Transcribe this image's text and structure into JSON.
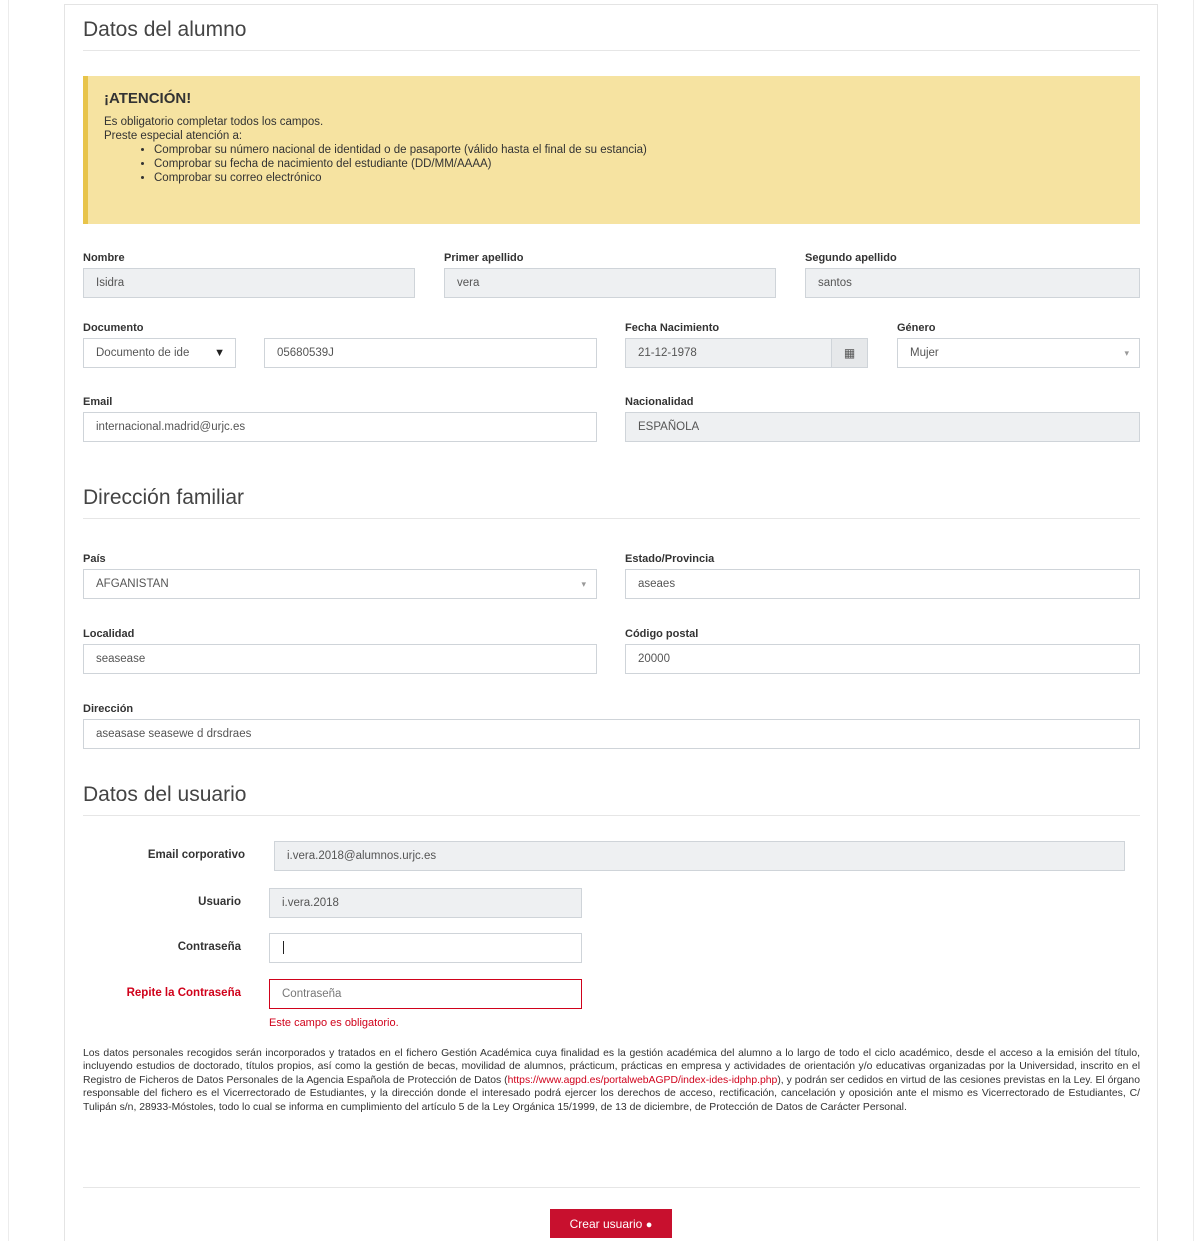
{
  "sections": {
    "alumno": "Datos del alumno",
    "direccion": "Dirección familiar",
    "usuario": "Datos del usuario"
  },
  "alert": {
    "title": "¡ATENCIÓN!",
    "line1": "Es obligatorio completar todos los campos.",
    "line2": "Preste especial atención a:",
    "items": [
      "Comprobar su número nacional de identidad o de pasaporte (válido hasta el final de su estancia)",
      "Comprobar su fecha de nacimiento del estudiante (DD/MM/AAAA)",
      "Comprobar su correo electrónico"
    ],
    "colors": {
      "background": "#f6e3a1",
      "border": "#e8c44a"
    }
  },
  "alumno": {
    "nombre": {
      "label": "Nombre",
      "value": "Isidra"
    },
    "apellido1": {
      "label": "Primer apellido",
      "value": "vera"
    },
    "apellido2": {
      "label": "Segundo apellido",
      "value": "santos"
    },
    "documento": {
      "label": "Documento",
      "type_value": "Documento de ide",
      "number_value": "05680539J"
    },
    "fecha": {
      "label": "Fecha Nacimiento",
      "value": "21-12-1978",
      "icon": "calendar-icon"
    },
    "genero": {
      "label": "Género",
      "value": "Mujer"
    },
    "email": {
      "label": "Email",
      "value": "internacional.madrid@urjc.es"
    },
    "nacionalidad": {
      "label": "Nacionalidad",
      "value": "ESPAÑOLA"
    }
  },
  "direccion": {
    "pais": {
      "label": "País",
      "value": "AFGANISTAN"
    },
    "estado": {
      "label": "Estado/Provincia",
      "value": "aseaes"
    },
    "localidad": {
      "label": "Localidad",
      "value": "seasease"
    },
    "cp": {
      "label": "Código postal",
      "value": "20000"
    },
    "direccion": {
      "label": "Dirección",
      "value": "aseasase seasewe d drsdraes"
    }
  },
  "usuario": {
    "email_corp": {
      "label": "Email corporativo",
      "value": "i.vera.2018@alumnos.urjc.es"
    },
    "usuario": {
      "label": "Usuario",
      "value": "i.vera.2018"
    },
    "contrasena": {
      "label": "Contraseña",
      "value": ""
    },
    "repite": {
      "label": "Repite la Contraseña",
      "placeholder": "Contraseña",
      "error": "Este campo es obligatorio."
    }
  },
  "legal": {
    "text_before": "Los datos personales recogidos serán incorporados y tratados en el fichero Gestión Académica cuya finalidad es la gestión académica del alumno a lo largo de todo el ciclo académico, desde el acceso a la emisión del título, incluyendo estudios de doctorado, títulos propios, así como la gestión de becas, movilidad de alumnos, prácticum, prácticas en empresa y actividades de orientación y/o educativas organizadas por la Universidad, inscrito en el Registro de Ficheros de Datos Personales de la Agencia Española de Protección de Datos (",
    "link": "https://www.agpd.es/portalwebAGPD/index-ides-idphp.php",
    "text_after": "), y podrán ser cedidos en virtud de las cesiones previstas en la Ley. El órgano responsable del fichero es el Vicerrectorado de Estudiantes, y la dirección donde el interesado podrá ejercer los derechos de acceso, rectificación, cancelación y oposición ante el mismo es Vicerrectorado de Estudiantes, C/ Tulipán s/n, 28933-Móstoles, todo lo cual se informa en cumplimiento del artículo 5 de la Ley Orgánica 15/1999, de 13 de diciembre, de Protección de Datos de Carácter Personal."
  },
  "submit": {
    "label": "Crear usuario",
    "icon": "user-icon",
    "color": "#c8102e"
  },
  "colors": {
    "error": "#d0021b",
    "readonly_bg": "#eef0f2"
  }
}
